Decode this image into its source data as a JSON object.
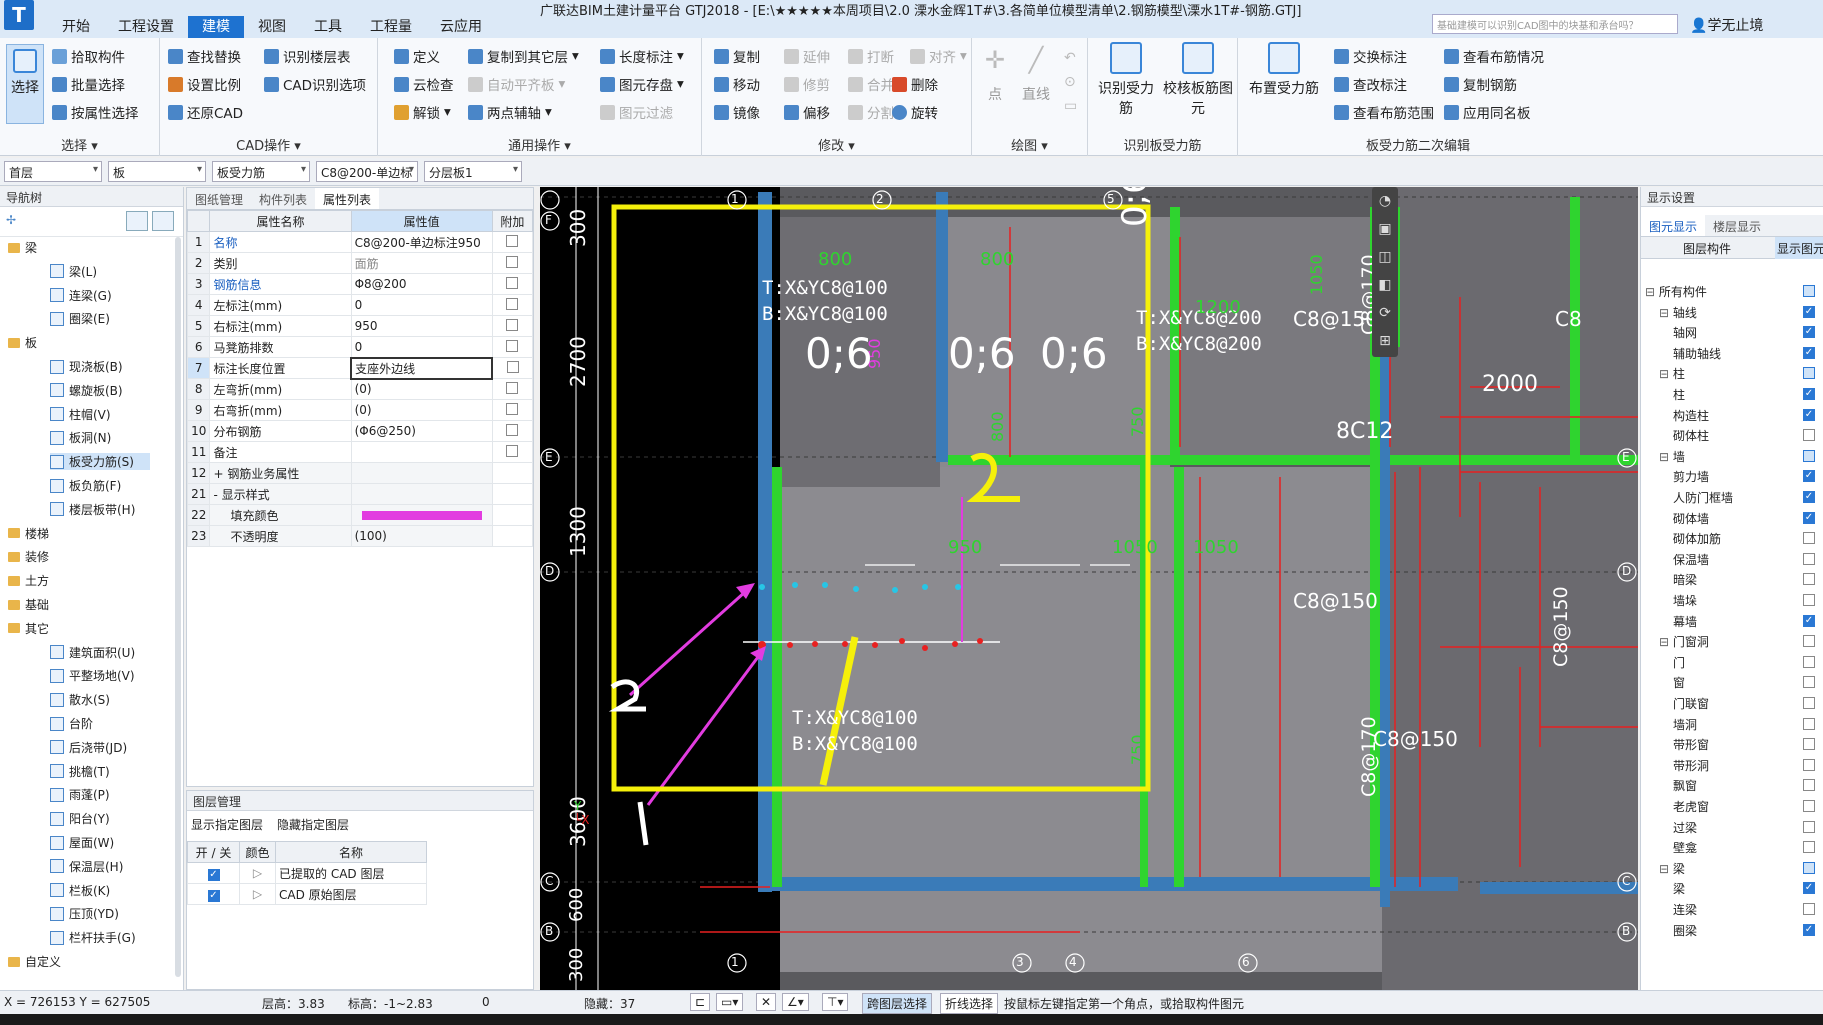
{
  "titlebar": {
    "title": "广联达BIM土建计量平台 GTJ2018 - [E:\\★★★★★本周项目\\2.0 溧水金辉1T#\\3.各简单位模型清单\\2.钢筋模型\\溧水1T#-钢筋.GTJ]",
    "menu": [
      "开始",
      "工程设置",
      "建模",
      "视图",
      "工具",
      "工程量",
      "云应用"
    ],
    "active_menu": "建模",
    "search_placeholder": "基础建模可以识别CAD图中的块基和承台吗？",
    "user": "学无止境"
  },
  "ribbon": {
    "select_big": "选择",
    "select_items": [
      "拾取构件",
      "批量选择",
      "按属性选择"
    ],
    "select_label": "选择",
    "cad_items": [
      "查找替换",
      "识别楼层表",
      "设置比例",
      "CAD识别选项",
      "还原CAD"
    ],
    "cad_label": "CAD操作",
    "general_items": [
      "定义",
      "复制到其它层",
      "长度标注",
      "云检查",
      "自动平齐板",
      "图元存盘",
      "解锁",
      "两点辅轴",
      "图元过滤"
    ],
    "general_label": "通用操作",
    "modify_items": [
      "复制",
      "延伸",
      "打断",
      "对齐",
      "移动",
      "修剪",
      "合并",
      "删除",
      "镜像",
      "偏移",
      "分割",
      "旋转"
    ],
    "modify_label": "修改",
    "draw_items": [
      "点",
      "直线"
    ],
    "draw_label": "绘图",
    "recog_items": [
      "识别受力筋",
      "校核板筋图元"
    ],
    "recog_label": "识别板受力筋",
    "second_big": "布置受力筋",
    "second_items": [
      "交换标注",
      "查看布筋情况",
      "查改标注",
      "复制钢筋",
      "查看布筋范围",
      "应用同名板"
    ],
    "second_label": "板受力筋二次编辑"
  },
  "propbar": {
    "floor": "首层",
    "type": "板",
    "sub": "板受力筋",
    "name": "C8@200-单边标",
    "layer": "分层板1"
  },
  "nav": {
    "title": "导航树",
    "items": [
      {
        "label": "梁",
        "level": 0
      },
      {
        "label": "梁(L)",
        "level": 1
      },
      {
        "label": "连梁(G)",
        "level": 1
      },
      {
        "label": "圈梁(E)",
        "level": 1
      },
      {
        "label": "板",
        "level": 0
      },
      {
        "label": "现浇板(B)",
        "level": 1
      },
      {
        "label": "螺旋板(B)",
        "level": 1
      },
      {
        "label": "柱帽(V)",
        "level": 1
      },
      {
        "label": "板洞(N)",
        "level": 1
      },
      {
        "label": "板受力筋(S)",
        "level": 1,
        "selected": true
      },
      {
        "label": "板负筋(F)",
        "level": 1
      },
      {
        "label": "楼层板带(H)",
        "level": 1
      },
      {
        "label": "楼梯",
        "level": 0
      },
      {
        "label": "装修",
        "level": 0
      },
      {
        "label": "土方",
        "level": 0
      },
      {
        "label": "基础",
        "level": 0
      },
      {
        "label": "其它",
        "level": 0
      },
      {
        "label": "建筑面积(U)",
        "level": 1
      },
      {
        "label": "平整场地(V)",
        "level": 1
      },
      {
        "label": "散水(S)",
        "level": 1
      },
      {
        "label": "台阶",
        "level": 1
      },
      {
        "label": "后浇带(JD)",
        "level": 1
      },
      {
        "label": "挑檐(T)",
        "level": 1
      },
      {
        "label": "雨蓬(P)",
        "level": 1
      },
      {
        "label": "阳台(Y)",
        "level": 1
      },
      {
        "label": "屋面(W)",
        "level": 1
      },
      {
        "label": "保温层(H)",
        "level": 1
      },
      {
        "label": "栏板(K)",
        "level": 1
      },
      {
        "label": "压顶(YD)",
        "level": 1
      },
      {
        "label": "栏杆扶手(G)",
        "level": 1
      },
      {
        "label": "自定义",
        "level": 0
      }
    ]
  },
  "props": {
    "tabs": [
      "图纸管理",
      "构件列表",
      "属性列表"
    ],
    "headers": [
      "属性名称",
      "属性值",
      "附加"
    ],
    "rows": [
      {
        "n": "1",
        "name": "名称",
        "value": "C8@200-单边标注950",
        "blue": true
      },
      {
        "n": "2",
        "name": "类别",
        "value": "面筋",
        "gray": true
      },
      {
        "n": "3",
        "name": "钢筋信息",
        "value": "Φ8@200",
        "blue": true
      },
      {
        "n": "4",
        "name": "左标注(mm)",
        "value": "0"
      },
      {
        "n": "5",
        "name": "右标注(mm)",
        "value": "950"
      },
      {
        "n": "6",
        "name": "马凳筋排数",
        "value": "0"
      },
      {
        "n": "7",
        "name": "标注长度位置",
        "value": "支座外边线"
      },
      {
        "n": "8",
        "name": "左弯折(mm)",
        "value": "(0)"
      },
      {
        "n": "9",
        "name": "右弯折(mm)",
        "value": "(0)"
      },
      {
        "n": "10",
        "name": "分布钢筋",
        "value": "(Φ6@250)"
      },
      {
        "n": "11",
        "name": "备注",
        "value": ""
      },
      {
        "n": "12",
        "name": "+ 钢筋业务属性",
        "value": ""
      },
      {
        "n": "21",
        "name": "- 显示样式",
        "value": ""
      },
      {
        "n": "22",
        "name": "填充颜色",
        "value": ""
      },
      {
        "n": "23",
        "name": "不透明度",
        "value": "(100)"
      }
    ]
  },
  "layers": {
    "title": "图层管理",
    "actions": [
      "显示指定图层",
      "隐藏指定图层"
    ],
    "headers": [
      "开 / 关",
      "颜色",
      "名称"
    ],
    "rows": [
      "已提取的 CAD 图层",
      "CAD 原始图层"
    ]
  },
  "canvas": {
    "axis_top": [
      "1",
      "2",
      "5"
    ],
    "axis_bottom": [
      "1",
      "3",
      "4",
      "6"
    ],
    "axis_left": [
      "F",
      "E",
      "D",
      "C",
      "B"
    ],
    "axis_right": [
      "E",
      "D",
      "C",
      "B"
    ],
    "dims_left": [
      "300",
      "2700",
      "1300",
      "3600",
      "600",
      "300"
    ],
    "labels": {
      "a": "T:X&YC8@100",
      "b": "B:X&YC8@100",
      "c": "T:X&YC8@200",
      "d": "B:X&YC8@200",
      "e": "T:X&YC8@100",
      "f": "B:X&YC8@100",
      "c8150a": "C8@150",
      "c8150b": "C8@150",
      "c8150c": "C8@150",
      "c8170a": "C8@170",
      "c8170b": "C8@170",
      "c8150v": "C8@150",
      "n800a": "800",
      "n800b": "800",
      "n800c": "800",
      "n950": "950",
      "n950b": "950",
      "n1050a": "1050",
      "n1050b": "1050",
      "n1050c": "1050",
      "n1200": "1200",
      "n750a": "750",
      "n750b": "750",
      "n2000": "2000",
      "n8c12": "8C12",
      "c8x": "C8"
    },
    "hand": {
      "h1": "0;6",
      "h2": "0;6",
      "h3": "0;6",
      "h4": "0;6",
      "n2": "2",
      "n2b": "2",
      "n1": "1"
    },
    "colors": {
      "panel": "#8c8b90",
      "green": "#2fd42f",
      "yellow": "#f5f00a",
      "magenta": "#e23ce0",
      "red": "#e82020",
      "blue": "#3a7bb8"
    }
  },
  "right": {
    "title": "显示设置",
    "tabs": [
      "图元显示",
      "楼层显示"
    ],
    "headers": [
      "图层构件",
      "显示图元"
    ],
    "items": [
      {
        "label": "所有构件",
        "level": 0,
        "state": "partial"
      },
      {
        "label": "轴线",
        "level": 1,
        "state": "on"
      },
      {
        "label": "轴网",
        "level": 2,
        "state": "on"
      },
      {
        "label": "辅助轴线",
        "level": 2,
        "state": "on"
      },
      {
        "label": "柱",
        "level": 1,
        "state": "partial"
      },
      {
        "label": "柱",
        "level": 2,
        "state": "on"
      },
      {
        "label": "构造柱",
        "level": 2,
        "state": "on"
      },
      {
        "label": "砌体柱",
        "level": 2,
        "state": "off"
      },
      {
        "label": "墙",
        "level": 1,
        "state": "partial"
      },
      {
        "label": "剪力墙",
        "level": 2,
        "state": "on"
      },
      {
        "label": "人防门框墙",
        "level": 2,
        "state": "on"
      },
      {
        "label": "砌体墙",
        "level": 2,
        "state": "on"
      },
      {
        "label": "砌体加筋",
        "level": 2,
        "state": "off"
      },
      {
        "label": "保温墙",
        "level": 2,
        "state": "off"
      },
      {
        "label": "暗梁",
        "level": 2,
        "state": "off"
      },
      {
        "label": "墙垛",
        "level": 2,
        "state": "off"
      },
      {
        "label": "幕墙",
        "level": 2,
        "state": "on"
      },
      {
        "label": "门窗洞",
        "level": 1,
        "state": "off"
      },
      {
        "label": "门",
        "level": 2,
        "state": "off"
      },
      {
        "label": "窗",
        "level": 2,
        "state": "off"
      },
      {
        "label": "门联窗",
        "level": 2,
        "state": "off"
      },
      {
        "label": "墙洞",
        "level": 2,
        "state": "off"
      },
      {
        "label": "带形窗",
        "level": 2,
        "state": "off"
      },
      {
        "label": "带形洞",
        "level": 2,
        "state": "off"
      },
      {
        "label": "飘窗",
        "level": 2,
        "state": "off"
      },
      {
        "label": "老虎窗",
        "level": 2,
        "state": "off"
      },
      {
        "label": "过梁",
        "level": 2,
        "state": "off"
      },
      {
        "label": "壁龛",
        "level": 2,
        "state": "off"
      },
      {
        "label": "梁",
        "level": 1,
        "state": "partial"
      },
      {
        "label": "梁",
        "level": 2,
        "state": "on"
      },
      {
        "label": "连梁",
        "level": 2,
        "state": "off"
      },
      {
        "label": "圈梁",
        "level": 2,
        "state": "on"
      }
    ]
  },
  "status": {
    "coords": "X = 726153 Y = 627505",
    "floor_h": "层高：3.83",
    "elev": "标高：-1~2.83",
    "zero": "0",
    "hidden": "隐藏：37",
    "btn1": "跨图层选择",
    "btn2": "折线选择",
    "hint": "按鼠标左键指定第一个角点，或拾取构件图元"
  }
}
